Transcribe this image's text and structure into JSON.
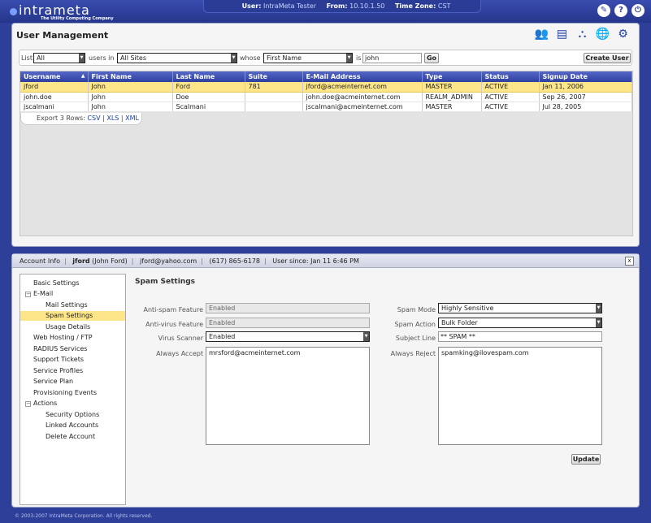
{
  "header": {
    "logo_text": "intrameta",
    "logo_tagline": "The Utility Computing Company",
    "user_label": "User:",
    "user_value": "IntraMeta Tester",
    "from_label": "From:",
    "from_value": "10.10.1.50",
    "tz_label": "Time Zone:",
    "tz_value": "CST",
    "icons": [
      "tools-icon",
      "help-icon",
      "power-icon"
    ]
  },
  "user_mgmt": {
    "title": "User Management",
    "app_icons": [
      "users-icon",
      "id-card-icon",
      "network-icon",
      "globe-icon",
      "gears-icon"
    ],
    "filter": {
      "list_label": "List",
      "list_value": "All",
      "users_in_label": "users in",
      "site_value": "All Sites",
      "whose_label": "whose",
      "field_value": "First Name",
      "is_label": "is",
      "search_value": "john",
      "go_label": "Go",
      "create_label": "Create User"
    },
    "columns": [
      "Username",
      "First Name",
      "Last Name",
      "Suite",
      "E-Mail Address",
      "Type",
      "Status",
      "Signup Date"
    ],
    "rows": [
      {
        "username": "jford",
        "first": "John",
        "last": "Ford",
        "suite": "781",
        "email": "jford@acmeinternet.com",
        "type": "MASTER",
        "status": "ACTIVE",
        "signup": "Jan 11, 2006"
      },
      {
        "username": "john.doe",
        "first": "John",
        "last": "Doe",
        "suite": "",
        "email": "john.doe@acmeinternet.com",
        "type": "REALM_ADMIN",
        "status": "ACTIVE",
        "signup": "Sep 26, 2007"
      },
      {
        "username": "jscalmani",
        "first": "John",
        "last": "Scalmani",
        "suite": "",
        "email": "jscalmani@acmeinternet.com",
        "type": "MASTER",
        "status": "ACTIVE",
        "signup": "Jul 28, 2005"
      }
    ],
    "export": {
      "prefix": "Export 3 Rows:",
      "csv": "CSV",
      "xls": "XLS",
      "xml": "XML"
    }
  },
  "account": {
    "tab": "Account Info",
    "username": "jford",
    "fullname": "(John Ford)",
    "email": "jford@yahoo.com",
    "phone": "(617) 865-6178",
    "since": "User since: Jan 11 6:46 PM",
    "close": "x"
  },
  "tree": [
    {
      "label": "Basic Settings",
      "level": 0
    },
    {
      "label": "E-Mail",
      "level": 0,
      "expander": "−"
    },
    {
      "label": "Mail Settings",
      "level": 1
    },
    {
      "label": "Spam Settings",
      "level": 1,
      "active": true
    },
    {
      "label": "Usage Details",
      "level": 1
    },
    {
      "label": "Web Hosting / FTP",
      "level": 0
    },
    {
      "label": "RADIUS Services",
      "level": 0
    },
    {
      "label": "Support Tickets",
      "level": 0
    },
    {
      "label": "Service Profiles",
      "level": 0
    },
    {
      "label": "Service Plan",
      "level": 0
    },
    {
      "label": "Provisioning Events",
      "level": 0
    },
    {
      "label": "Actions",
      "level": 0,
      "expander": "−"
    },
    {
      "label": "Security Options",
      "level": 1
    },
    {
      "label": "Linked Accounts",
      "level": 1
    },
    {
      "label": "Delete Account",
      "level": 1
    }
  ],
  "spam": {
    "title": "Spam Settings",
    "antispam_label": "Anti-spam Feature",
    "antispam_value": "Enabled",
    "antivirus_label": "Anti-virus Feature",
    "antivirus_value": "Enabled",
    "scanner_label": "Virus Scanner",
    "scanner_value": "Enabled",
    "accept_label": "Always Accept",
    "accept_value": "mrsford@acmeinternet.com",
    "mode_label": "Spam Mode",
    "mode_value": "Highly Sensitive",
    "action_label": "Spam Action",
    "action_value": "Bulk Folder",
    "subject_label": "Subject Line",
    "subject_value": "** SPAM **",
    "reject_label": "Always Reject",
    "reject_value": "spamking@ilovespam.com",
    "update_label": "Update"
  },
  "footer": "© 2003-2007 IntraMeta Corporation.  All rights reserved."
}
